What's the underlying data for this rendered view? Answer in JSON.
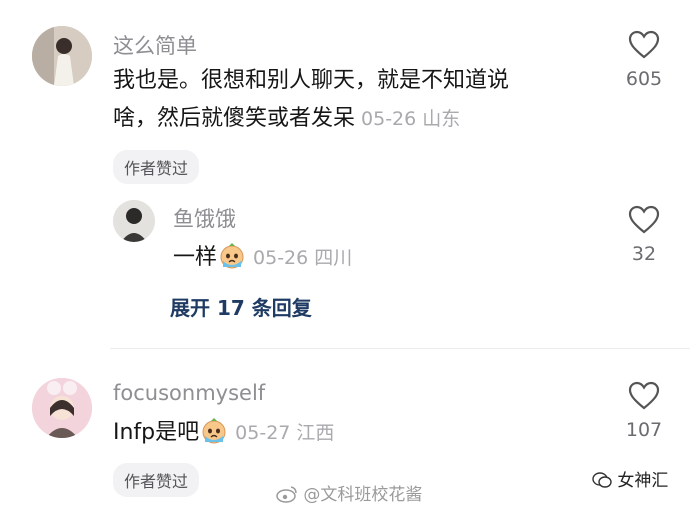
{
  "comments": [
    {
      "username": "这么简单",
      "text_line1": "我也是。很想和别人聊天，就是不知道说",
      "text_line2": "啥，然后就傻笑或者发呆",
      "date_location": "05-26 山东",
      "likes": "605",
      "author_liked": "作者赞过",
      "reply": {
        "username": "鱼饿饿",
        "text": "一样",
        "emoji": "crying-emoji",
        "date_location": "05-26 四川",
        "likes": "32"
      },
      "expand_label": "展开 17 条回复"
    },
    {
      "username": "focusonmyself",
      "text": "Infp是吧",
      "emoji": "crying-emoji",
      "date_location": "05-27 江西",
      "likes": "107",
      "author_liked": "作者赞过"
    }
  ],
  "watermark": "@文科班校花酱",
  "brand": "女神汇",
  "colors": {
    "accent_link": "#1f3b63",
    "meta": "#a9a9ae"
  }
}
